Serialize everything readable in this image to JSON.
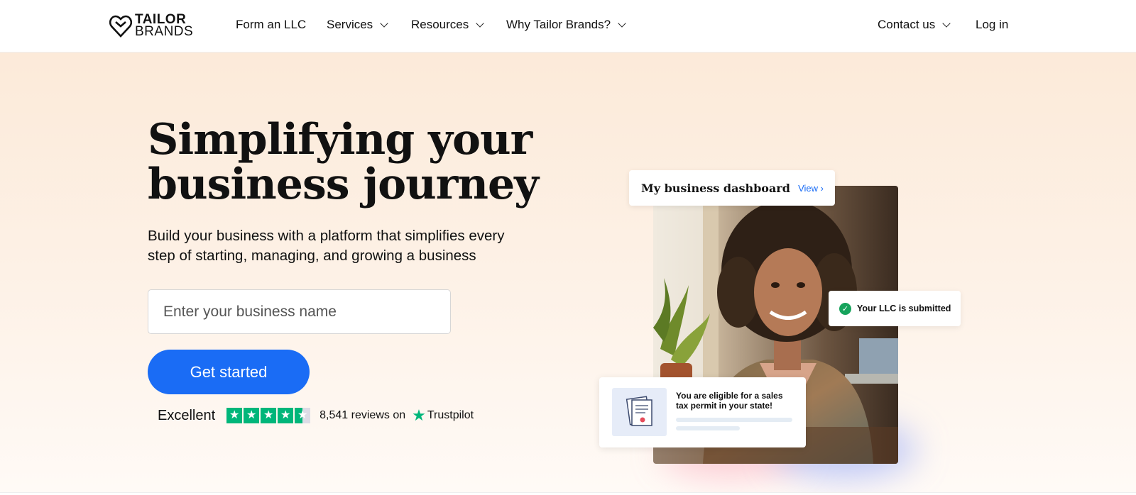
{
  "nav": {
    "logo_line1": "TAILOR",
    "logo_line2": "BRANDS",
    "items": [
      {
        "label": "Form an LLC",
        "dropdown": false
      },
      {
        "label": "Services",
        "dropdown": true
      },
      {
        "label": "Resources",
        "dropdown": true
      },
      {
        "label": "Why Tailor Brands?",
        "dropdown": true
      }
    ],
    "contact_label": "Contact us",
    "login_label": "Log in"
  },
  "hero": {
    "headline_line1": "Simplifying your",
    "headline_line2": "business journey",
    "subhead": "Build your business with a platform that simplifies every step of starting, managing, and growing a business",
    "input_placeholder": "Enter your business name",
    "cta_label": "Get started"
  },
  "trustpilot": {
    "rating_word": "Excellent",
    "stars": 4.5,
    "reviews_text": "8,541 reviews on",
    "brand": "Trustpilot"
  },
  "visual": {
    "dashboard_title": "My business dashboard",
    "dashboard_link": "View",
    "llc_status": "Your LLC is submitted",
    "tax_message": "You are eligible for a sales tax permit in your state!"
  },
  "colors": {
    "accent": "#1a6cf5",
    "trustpilot_green": "#00b67a",
    "success_green": "#17a35c",
    "hero_bg": "#fcead9"
  }
}
